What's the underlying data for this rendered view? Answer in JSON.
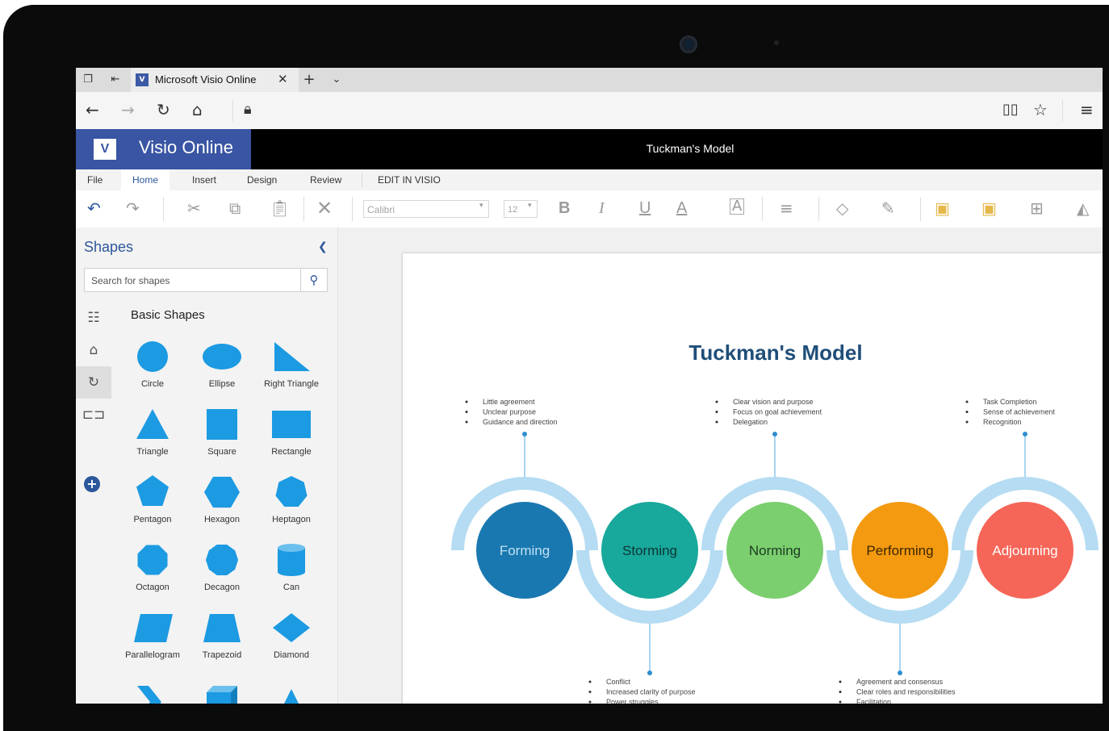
{
  "browser": {
    "tab_title": "Microsoft Visio Online",
    "tab_favicon": "V"
  },
  "app": {
    "brand_logo": "V",
    "brand_name": "Visio Online",
    "document_title": "Tuckman's Model"
  },
  "ribbon": {
    "tabs": [
      {
        "label": "File"
      },
      {
        "label": "Home"
      },
      {
        "label": "Insert"
      },
      {
        "label": "Design"
      },
      {
        "label": "Review"
      },
      {
        "label": "EDIT IN VISIO"
      }
    ],
    "active_tab": "Home",
    "font_name": "Calibri",
    "font_size": "12"
  },
  "shapes_panel": {
    "title": "Shapes",
    "search_placeholder": "Search for shapes",
    "stencil_title": "Basic Shapes",
    "shapes": [
      {
        "label": "Circle",
        "kind": "circle"
      },
      {
        "label": "Ellipse",
        "kind": "ellipse"
      },
      {
        "label": "Right Triangle",
        "kind": "right-triangle"
      },
      {
        "label": "Triangle",
        "kind": "triangle"
      },
      {
        "label": "Square",
        "kind": "square"
      },
      {
        "label": "Rectangle",
        "kind": "rectangle"
      },
      {
        "label": "Pentagon",
        "kind": "pentagon"
      },
      {
        "label": "Hexagon",
        "kind": "hexagon"
      },
      {
        "label": "Heptagon",
        "kind": "heptagon"
      },
      {
        "label": "Octagon",
        "kind": "octagon"
      },
      {
        "label": "Decagon",
        "kind": "decagon"
      },
      {
        "label": "Can",
        "kind": "can"
      },
      {
        "label": "Parallelogram",
        "kind": "parallelogram"
      },
      {
        "label": "Trapezoid",
        "kind": "trapezoid"
      },
      {
        "label": "Diamond",
        "kind": "diamond"
      },
      {
        "label": "",
        "kind": "chevron"
      },
      {
        "label": "",
        "kind": "cube"
      },
      {
        "label": "",
        "kind": "drop"
      }
    ]
  },
  "diagram": {
    "title": "Tuckman's Model",
    "stages": [
      {
        "name": "Forming",
        "color": "#1a78b0",
        "bullets": [
          "Little agreement",
          "Unclear purpose",
          "Guidance and direction"
        ],
        "position": "top"
      },
      {
        "name": "Storming",
        "color": "#18a89c",
        "bullets": [
          "Conflict",
          "Increased clarity of purpose",
          "Power struggles"
        ],
        "position": "bottom"
      },
      {
        "name": "Norming",
        "color": "#7bcf6e",
        "bullets": [
          "Clear vision and purpose",
          "Focus on goal achievement",
          "Delegation"
        ],
        "position": "top"
      },
      {
        "name": "Performing",
        "color": "#f39a10",
        "bullets": [
          "Agreement and consensus",
          "Clear roles and responsibilities",
          "Facilitation"
        ],
        "position": "bottom"
      },
      {
        "name": "Adjourning",
        "color": "#f56658",
        "bullets": [
          "Task Completion",
          "Sense of achievement",
          "Recognition"
        ],
        "position": "top"
      }
    ],
    "arc_color": "#b5dcf2",
    "connector_color": "#2f8fd0"
  },
  "colors": {
    "brand": "#3955a3",
    "accent": "#2b579a",
    "shape_fill": "#1c9ae2"
  }
}
